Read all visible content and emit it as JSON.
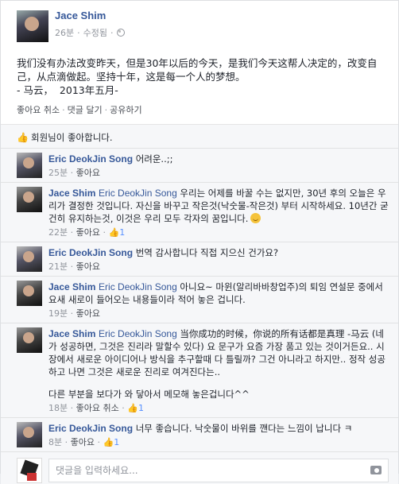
{
  "post": {
    "author": "Jace Shim",
    "time": "26분",
    "edited": "수정됨",
    "privacy_icon": "globe-icon",
    "text": "我们没有办法改变昨天，但是30年以后的今天，是我们今天这帮人决定的，改变自己，从点滴做起。坚持十年，这是每一个人的梦想。\n- 马云，  2013年五月-",
    "actions": [
      "좋아요 취소",
      "댓글 달기",
      "공유하기"
    ]
  },
  "likes": {
    "text": "회원님이 좋아합니다."
  },
  "comments": [
    {
      "name": "Eric DeokJin Song",
      "mention": "",
      "text": "어려운..;;",
      "time": "25분",
      "like": "좋아요",
      "unlike": "",
      "count": ""
    },
    {
      "name": "Jace Shim",
      "mention": "Eric DeokJin Song",
      "text": "우리는 어제를 바꿀 수는 없지만, 30년 후의 오늘은 우리가 결정한 것입니다. 자신을 바꾸고 작은것(낙숫물-작은것) 부터 시작하세요. 10년간 굳건히 유지하는것, 이것은 우리 모두 각자의 꿈입니다.",
      "time": "22분",
      "like": "좋아요",
      "unlike": "",
      "count": "1"
    },
    {
      "name": "Eric DeokJin Song",
      "mention": "",
      "text": "번역 감사합니다 직접 지으신 건가요?",
      "time": "21분",
      "like": "좋아요",
      "unlike": "",
      "count": ""
    },
    {
      "name": "Jace Shim",
      "mention": "Eric DeokJin Song",
      "text": "아니요~ 마윈(알리바바창업주)의 퇴임 연설문 중에서 요새 새로이 들어오는 내용들이라 적어 놓은 겁니다.",
      "time": "19분",
      "like": "좋아요",
      "unlike": "",
      "count": ""
    },
    {
      "name": "Jace Shim",
      "mention": "Eric DeokJin Song",
      "text": "当你成功的时候，你说的所有话都是真理 -马云 (네가 성공하면, 그것은 진리라 말할수 있다) 요 문구가 요즘 가장 품고 있는 것이거든요.. 시장에서 새로운 아이디어나 방식을 추구할때 다 틀릴까? 그건 아니라고 하지만.. 정작 성공하고 나면 그것은 새로운 진리로 여겨진다는..",
      "extra": "다른 부분을 보다가 와 닿아서 메모해 놓은겁니다^^",
      "time": "18분",
      "like": "좋아요",
      "unlike": "취소",
      "count": "1"
    },
    {
      "name": "Eric DeokJin Song",
      "mention": "",
      "text": "너무 좋습니다. 낙숫물이 바위를 깬다는 느낌이 납니다 ㅋ",
      "time": "8분",
      "like": "좋아요",
      "unlike": "",
      "count": "1"
    }
  ],
  "reply": {
    "placeholder": "댓글을 입력하세요...",
    "camera_icon": "camera-icon"
  }
}
